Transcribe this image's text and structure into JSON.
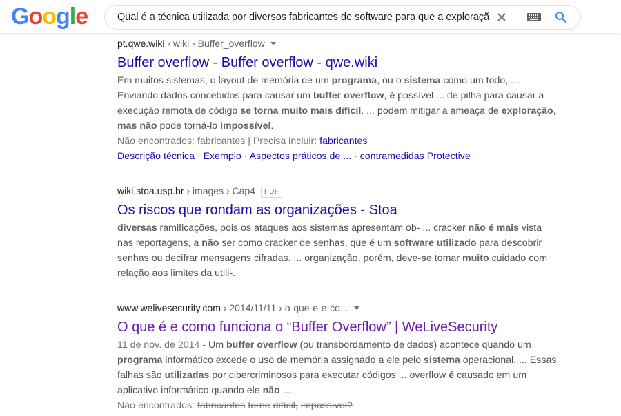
{
  "logo": [
    "G",
    "o",
    "o",
    "g",
    "l",
    "e"
  ],
  "search": {
    "query": "Qual é a técnica utilizada por diversos fabricantes de software para que a exploração"
  },
  "results": [
    {
      "domain": "pt.qwe.wiki",
      "path": " › wiki › Buffer_overflow",
      "title": "Buffer overflow - Buffer overflow - qwe.wiki",
      "snippet": [
        [
          "Em muitos sistemas, o layout de memória de um ",
          0
        ],
        [
          "programa",
          1
        ],
        [
          ", ou o ",
          0
        ],
        [
          "sistema",
          1
        ],
        [
          " como um todo, ...",
          0
        ],
        [
          " Enviando dados concebidos para causar um ",
          0
        ],
        [
          "buffer overflow",
          1
        ],
        [
          ", ",
          0
        ],
        [
          "é",
          1
        ],
        [
          " possível ... de pilha para causar a execução remota de código ",
          0
        ],
        [
          "se torna muito mais difícil",
          1
        ],
        [
          ". ... podem mitigar a ameaça de ",
          0
        ],
        [
          "exploração",
          1
        ],
        [
          ", ",
          0
        ],
        [
          "mas não",
          1
        ],
        [
          " pode torná-lo ",
          0
        ],
        [
          "impossível",
          1
        ],
        [
          ".",
          0
        ]
      ],
      "missing_label": "Não encontrados: ",
      "missing_terms": [
        "fabricantes"
      ],
      "include_label": " | Precisa incluir: ",
      "include_term": "fabricantes",
      "sitelinks": [
        "Descrição técnica",
        "Exemplo",
        "Aspectos práticos de ...",
        "contramedidas Protective"
      ],
      "sitelink_sep": " · "
    },
    {
      "domain": "wiki.stoa.usp.br",
      "path": " › images › Cap4",
      "badge": "PDF",
      "title": "Os riscos que rondam as organizações - Stoa",
      "snippet": [
        [
          "diversas",
          1
        ],
        [
          " ramificações, pois os ataques aos sistemas apresentam ob- ... cracker ",
          0
        ],
        [
          "não é mais",
          1
        ],
        [
          " vista nas reportagens, a ",
          0
        ],
        [
          "não",
          1
        ],
        [
          " ser como cracker de senhas, que ",
          0
        ],
        [
          "é",
          1
        ],
        [
          " um ",
          0
        ],
        [
          "software utilizado",
          1
        ],
        [
          " para descobrir senhas ou decifrar mensagens cifradas. ... organização, porém, deve-",
          0
        ],
        [
          "se",
          1
        ],
        [
          " tomar ",
          0
        ],
        [
          "muito",
          1
        ],
        [
          " cuidado com relação aos limites da utili-.",
          0
        ]
      ]
    },
    {
      "domain": "www.welivesecurity.com",
      "path": " › 2014/11/11 › o-que-e-e-co...",
      "title": "O que é e como funciona o “Buffer Overflow” | WeLiveSecurity",
      "date": "11 de nov. de 2014",
      "date_sep": " - ",
      "snippet": [
        [
          "Um ",
          0
        ],
        [
          "buffer overflow",
          1
        ],
        [
          " (ou transbordamento de dados) acontece quando um ",
          0
        ],
        [
          "programa",
          1
        ],
        [
          " informático excede o uso de memória assignado a ele pelo ",
          0
        ],
        [
          "sistema",
          1
        ],
        [
          " operacional, ... Essas falhas são ",
          0
        ],
        [
          "utilizadas",
          1
        ],
        [
          " por cibercriminosos para executar códigos ... overflow ",
          0
        ],
        [
          "é",
          1
        ],
        [
          " causado em um aplicativo informático quando ele ",
          0
        ],
        [
          "não",
          1
        ],
        [
          " ...",
          0
        ]
      ],
      "missing_label": "Não encontrados: ",
      "missing_terms": [
        "fabricantes",
        "torne",
        "difícil,",
        "impossível?"
      ]
    }
  ]
}
